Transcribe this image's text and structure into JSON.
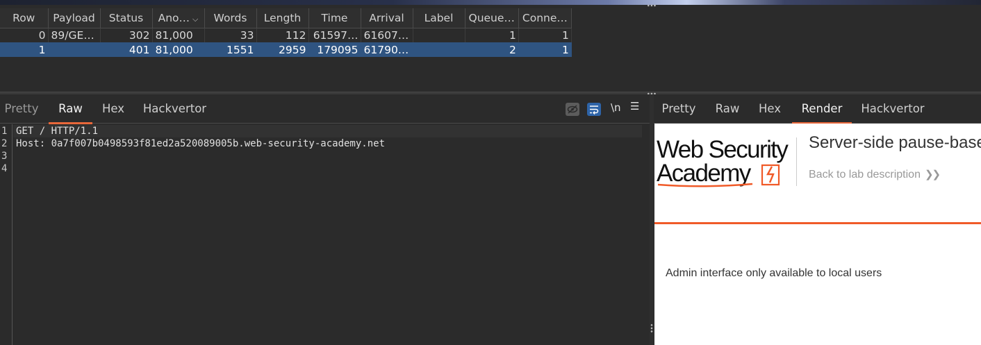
{
  "results": {
    "columns": [
      "Row",
      "Payload",
      "Status",
      "Ano…",
      "Words",
      "Length",
      "Time",
      "Arrival",
      "Label",
      "Queue…",
      "Conne…"
    ],
    "rows": [
      {
        "row": "0",
        "payload": "89/GE…",
        "status": "302",
        "anomaly": "81,000",
        "words": "33",
        "length": "112",
        "time": "61597…",
        "arrival": "61607…",
        "label": "",
        "queue": "1",
        "conn": "1"
      },
      {
        "row": "1",
        "payload": "",
        "status": "401",
        "anomaly": "81,000",
        "words": "1551",
        "length": "2959",
        "time": "179095",
        "arrival": "61790…",
        "label": "",
        "queue": "2",
        "conn": "1"
      }
    ],
    "selected_row": 1,
    "sorted_column": "Ano…"
  },
  "request": {
    "tabs": [
      "Pretty",
      "Raw",
      "Hex",
      "Hackvertor"
    ],
    "active_tab": "Raw",
    "toolbar": {
      "newline_label": "\\n",
      "menu_icon": "hamburger-icon"
    },
    "lines": [
      {
        "n": "1",
        "text": "GET / HTTP/1.1"
      },
      {
        "n": "2",
        "text": "Host: 0a7f007b0498593f81ed2a520089005b.web-security-academy.net"
      },
      {
        "n": "3",
        "text": ""
      },
      {
        "n": "4",
        "text": ""
      }
    ]
  },
  "response": {
    "tabs": [
      "Pretty",
      "Raw",
      "Hex",
      "Render",
      "Hackvertor"
    ],
    "active_tab": "Render",
    "render": {
      "logo_line1": "Web Security",
      "logo_line2": "Academy",
      "lab_title": "Server-side pause-base",
      "back_link": "Back to lab description",
      "message": "Admin interface only available to local users",
      "brand_color": "#f05a28"
    }
  },
  "colors": {
    "accent_tab": "#e8673a",
    "selection": "#2f5481",
    "wrap_button": "#2e64a8"
  }
}
